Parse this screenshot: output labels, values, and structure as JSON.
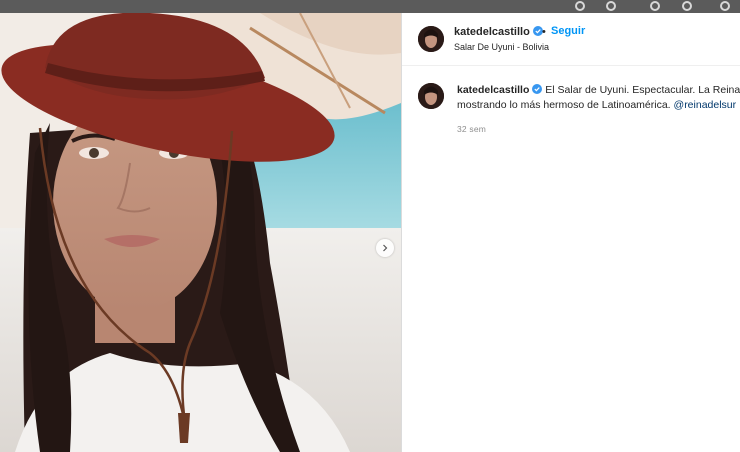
{
  "post": {
    "username": "katedelcastillo",
    "follow_label": "Seguir",
    "separator": "•",
    "location": "Salar De Uyuni - Bolivia",
    "caption_line1": "El Salar de Uyuni. Espectacular. La Reina d",
    "caption_line2_prefix": "mostrando lo más hermoso de Latinoamérica. ",
    "caption_mention": "@reinadelsur",
    "timestamp": "32 sem"
  },
  "icons": {
    "verified": "verified-badge-icon",
    "next": "chevron-right-icon"
  },
  "colors": {
    "link_blue": "#0095f6",
    "verified_blue": "#3897f0",
    "text": "#262626",
    "muted": "#8e8e8e"
  }
}
